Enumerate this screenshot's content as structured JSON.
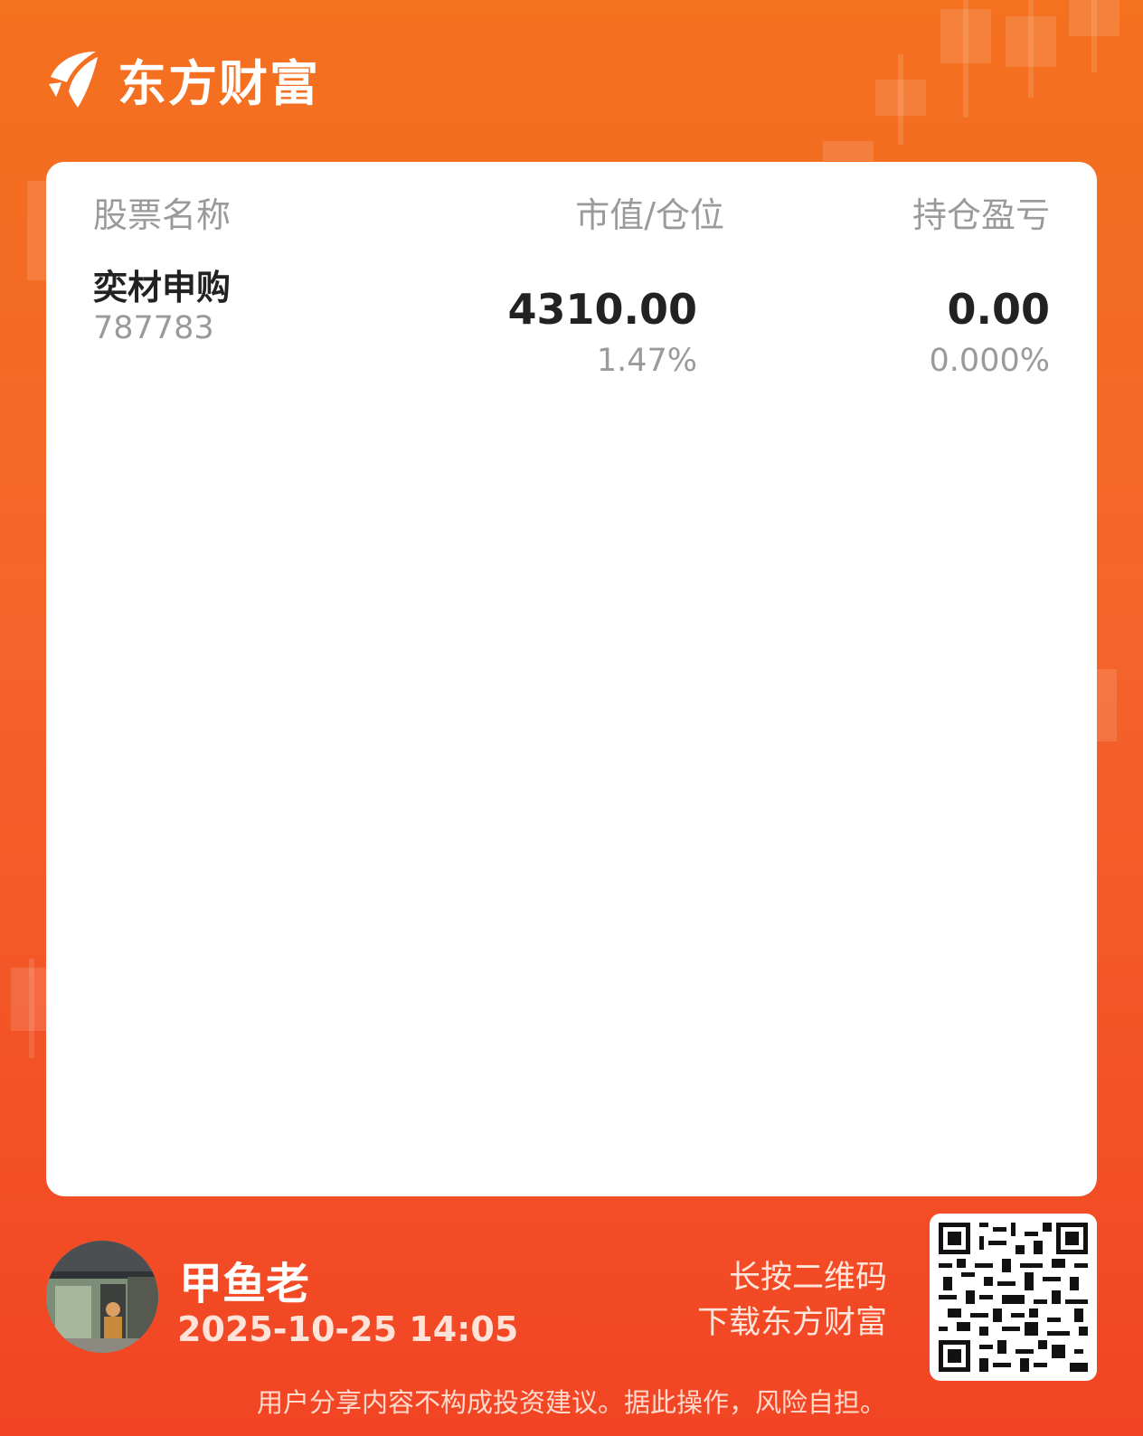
{
  "brand": {
    "name": "东方财富",
    "color": "#f4651f"
  },
  "table": {
    "headers": {
      "name": "股票名称",
      "market_value": "市值/仓位",
      "pnl": "持仓盈亏"
    },
    "rows": [
      {
        "name": "奕材申购",
        "code": "787783",
        "market_value": "4310.00",
        "position_pct": "1.47%",
        "pnl": "0.00",
        "pnl_pct": "0.000%"
      }
    ]
  },
  "footer": {
    "username": "甲鱼老",
    "timestamp": "2025-10-25 14:05",
    "qr_hint_line1": "长按二维码",
    "qr_hint_line2": "下载东方财富",
    "disclaimer": "用户分享内容不构成投资建议。据此操作，风险自担。"
  },
  "icons": {
    "logo": "eastmoney-logo-icon",
    "qr": "qr-code-icon",
    "avatar": "user-avatar"
  }
}
